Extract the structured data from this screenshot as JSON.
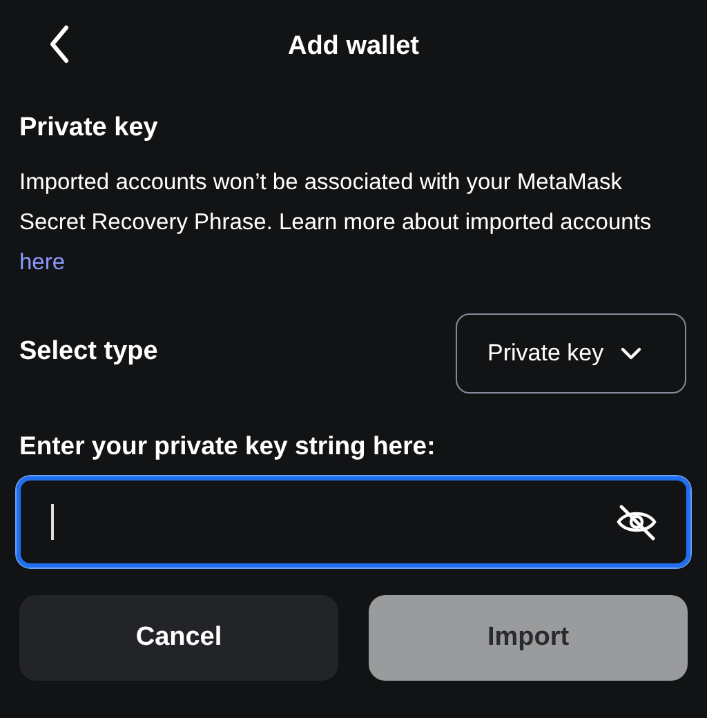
{
  "header": {
    "title": "Add wallet"
  },
  "section": {
    "title": "Private key",
    "description": "Imported accounts won’t be associated with your MetaMask Secret Recovery Phrase. Learn more about imported accounts ",
    "link": "here"
  },
  "select": {
    "label": "Select type",
    "value": "Private key"
  },
  "field": {
    "label": "Enter your private key string here:",
    "focused": true,
    "value_hidden": true
  },
  "buttons": [
    {
      "label": "Cancel",
      "kind": "secondary",
      "disabled": false
    },
    {
      "label": "Import",
      "kind": "primary",
      "disabled": true
    }
  ]
}
